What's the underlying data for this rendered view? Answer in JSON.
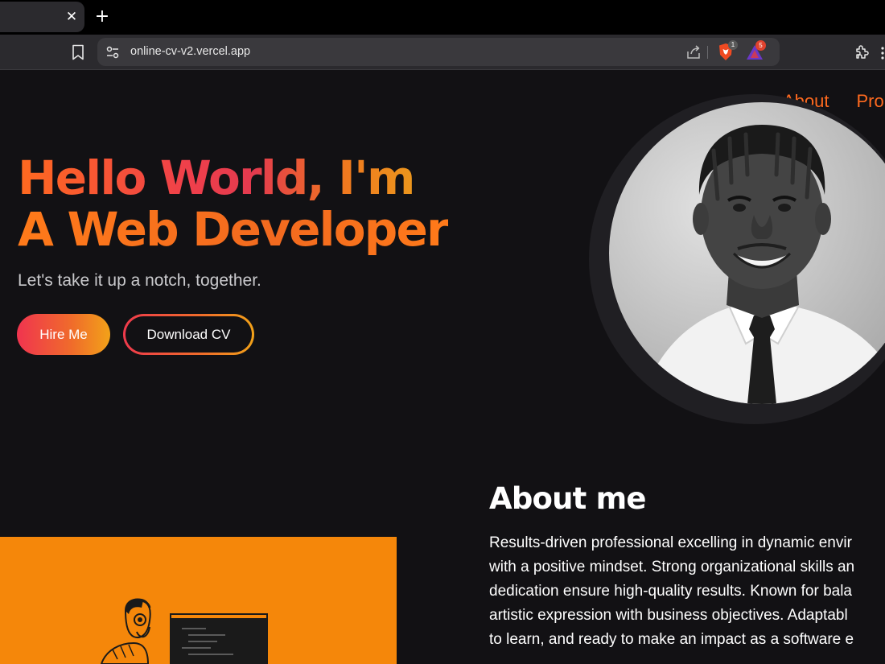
{
  "browser": {
    "url": "online-cv-v2.vercel.app",
    "tab_close": "✕",
    "new_tab": "+",
    "shields_badge": "1",
    "rewards_badge": "5"
  },
  "nav": {
    "items": [
      "About",
      "Pro"
    ]
  },
  "hero": {
    "line1": "Hello World, I'm",
    "line2": "A Web Developer",
    "subtitle": "Let's take it up a notch, together.",
    "hire_label": "Hire Me",
    "download_label": "Download CV"
  },
  "about": {
    "title": "About me",
    "lines": [
      "Results-driven professional excelling in dynamic envir",
      "with a positive mindset. Strong organizational skills an",
      "dedication ensure high-quality results. Known for bala",
      "artistic expression with business objectives. Adaptabl",
      "to learn, and ready to make an impact as a software e"
    ]
  },
  "colors": {
    "accent": "#ff6a1f",
    "gradient_start": "#f0344f",
    "gradient_end": "#f2a219",
    "illustration_bg": "#f5870a",
    "page_bg": "#121114"
  }
}
